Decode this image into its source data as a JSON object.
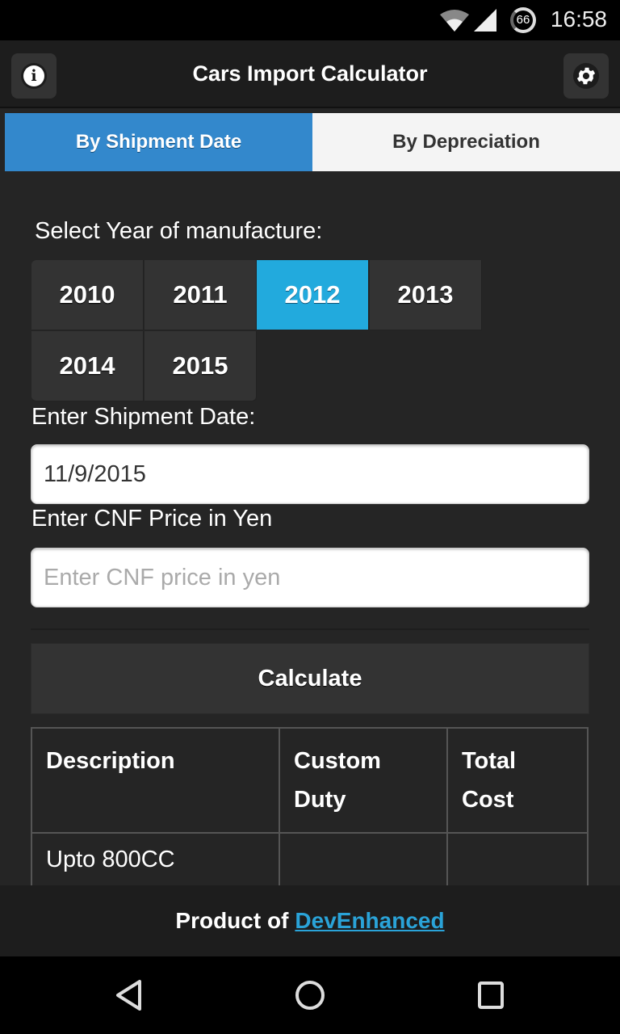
{
  "status_bar": {
    "time": "16:58",
    "battery_level": "66",
    "icons": [
      "wifi-icon",
      "signal-icon",
      "battery-icon"
    ]
  },
  "header": {
    "title": "Cars Import Calculator",
    "left_icon": "info-icon",
    "right_icon": "gear-icon"
  },
  "tabs": [
    {
      "label": "By Shipment Date",
      "active": true
    },
    {
      "label": "By Depreciation",
      "active": false
    }
  ],
  "form": {
    "year_label": "Select Year of manufacture:",
    "years": [
      "2010",
      "2011",
      "2012",
      "2013",
      "2014",
      "2015"
    ],
    "selected_year": "2012",
    "shipment_label": "Enter Shipment Date:",
    "shipment_value": "11/9/2015",
    "cnf_label": "Enter CNF Price in Yen",
    "cnf_value": "",
    "cnf_placeholder": "Enter CNF price in yen",
    "calculate_label": "Calculate"
  },
  "table": {
    "headers": [
      "Description",
      "Custom Duty",
      "Total Cost"
    ],
    "rows": [
      [
        "Upto 800CC",
        "",
        ""
      ]
    ]
  },
  "footer": {
    "prefix": "Product of",
    "link_text": "DevEnhanced",
    "link_color": "#2aa3d8"
  },
  "colors": {
    "tab_active": "#3388cc",
    "year_selected": "#22aadd",
    "background": "#252525"
  }
}
